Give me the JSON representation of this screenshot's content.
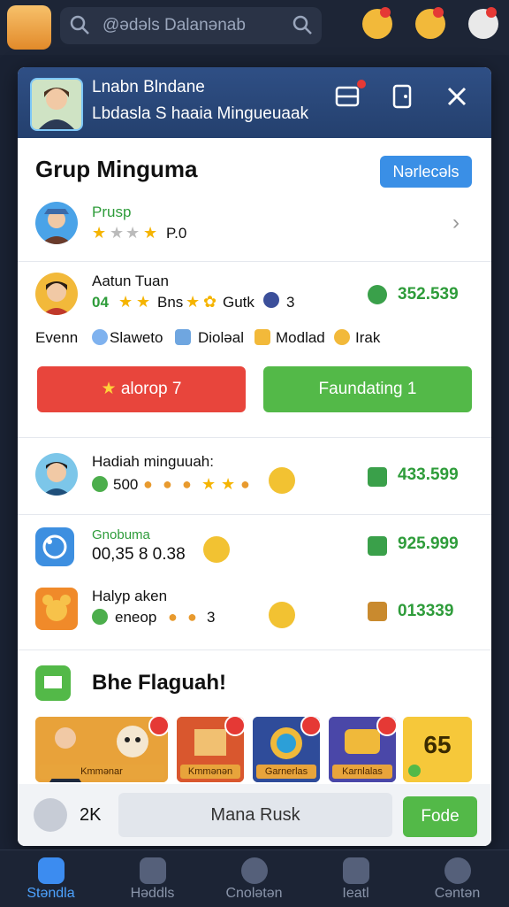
{
  "topbar": {
    "search_text": "@ədəls Dalanənab",
    "icons": [
      "app-avatar",
      "search-icon",
      "chat-icon",
      "coin-icon",
      "gift-icon",
      "notification-icon"
    ]
  },
  "modal": {
    "header": {
      "line1": "Lnabn Blndane",
      "line2": "Lbdasla S haaia Mingueuaak"
    },
    "title": "Grup Minguma",
    "pill_button": "Nərlecəls",
    "group_row": {
      "name": "Prusp",
      "rating": "P.0"
    },
    "member": {
      "name": "Aatun Tuan",
      "level": "04",
      "stat1": "Bns",
      "stat2": "Gutk",
      "stat3": "3",
      "value": "352.539"
    },
    "tags": [
      "Evenn",
      "Slaweto",
      "Dioləal",
      "Modlad",
      "Irak"
    ],
    "red_button": "alorop 7",
    "green_button": "Faundating 1",
    "rewards": [
      {
        "title": "Hadiah minguuah:",
        "sub": "500",
        "value": "433.599"
      },
      {
        "title": "Gnobuma",
        "sub": "00,35 8 0.38",
        "value": "925.999"
      },
      {
        "title": "Halyp aken",
        "sub": "eneop",
        "sub2": "3",
        "value": "013339"
      }
    ],
    "leaderboard_title": "Bhe Flaguah!",
    "tiles": [
      {
        "caption": "Kmmənar"
      },
      {
        "caption": "Kmmənən"
      },
      {
        "caption": "Garnerlas"
      },
      {
        "caption": "Karnlalas"
      },
      {
        "number": "65"
      }
    ],
    "footer": {
      "count": "2K",
      "field_text": "Mana Rusk",
      "go_button": "Fode"
    }
  },
  "bottom_nav": [
    {
      "label": "Stəndla"
    },
    {
      "label": "Həddls"
    },
    {
      "label": "Cnolətən"
    },
    {
      "label": "Ieatl"
    },
    {
      "label": "Cəntən"
    }
  ],
  "colors": {
    "accent": "#3a8fe6",
    "green": "#2e9c3a",
    "red": "#e8453c",
    "header": "#2f4f85"
  }
}
